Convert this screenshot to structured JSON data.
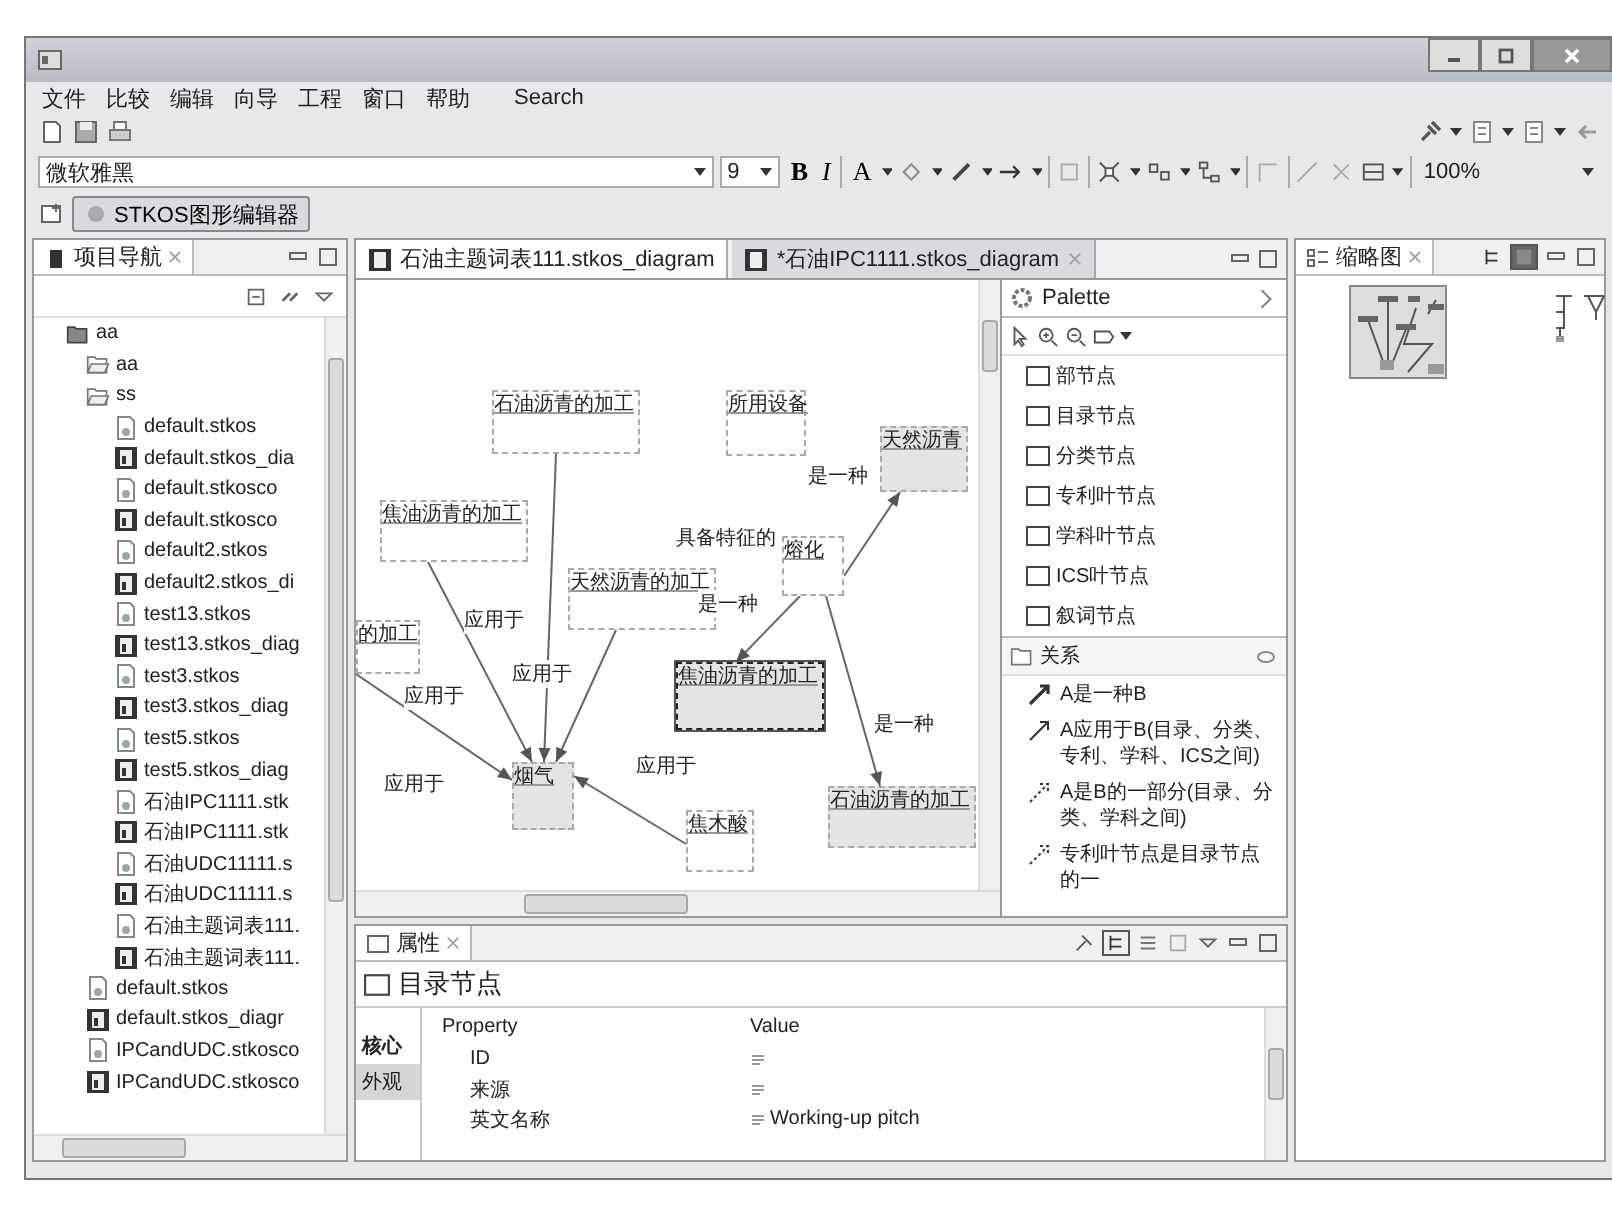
{
  "menu": [
    "文件",
    "比较",
    "编辑",
    "向导",
    "工程",
    "窗口",
    "帮助",
    "Search"
  ],
  "toolbar": {
    "font": "微软雅黑",
    "size": "9",
    "bold": "B",
    "italic": "I",
    "font_color": "A",
    "zoom": "100%"
  },
  "perspective": "STKOS图形编辑器",
  "navigator": {
    "title": "项目导航",
    "tree": [
      {
        "label": "aa",
        "kind": "project",
        "children": [
          {
            "label": "aa",
            "kind": "folder"
          },
          {
            "label": "ss",
            "kind": "folder",
            "children": [
              {
                "label": "default.stkos",
                "kind": "model"
              },
              {
                "label": "default.stkos_dia",
                "kind": "diagram"
              },
              {
                "label": "default.stkosco",
                "kind": "model"
              },
              {
                "label": "default.stkosco",
                "kind": "diagram"
              },
              {
                "label": "default2.stkos",
                "kind": "model"
              },
              {
                "label": "default2.stkos_di",
                "kind": "diagram"
              },
              {
                "label": "test13.stkos",
                "kind": "model"
              },
              {
                "label": "test13.stkos_diag",
                "kind": "diagram"
              },
              {
                "label": "test3.stkos",
                "kind": "model"
              },
              {
                "label": "test3.stkos_diag",
                "kind": "diagram"
              },
              {
                "label": "test5.stkos",
                "kind": "model"
              },
              {
                "label": "test5.stkos_diag",
                "kind": "diagram"
              },
              {
                "label": "石油IPC1111.stk",
                "kind": "model"
              },
              {
                "label": "石油IPC1111.stk",
                "kind": "diagram"
              },
              {
                "label": "石油UDC11111.s",
                "kind": "model"
              },
              {
                "label": "石油UDC11111.s",
                "kind": "diagram"
              },
              {
                "label": "石油主题词表111.",
                "kind": "model"
              },
              {
                "label": "石油主题词表111.",
                "kind": "diagram"
              }
            ]
          },
          {
            "label": "default.stkos",
            "kind": "model"
          },
          {
            "label": "default.stkos_diagr",
            "kind": "diagram"
          },
          {
            "label": "IPCandUDC.stkosco",
            "kind": "model"
          },
          {
            "label": "IPCandUDC.stkosco",
            "kind": "diagram"
          }
        ]
      }
    ]
  },
  "editor": {
    "tabs": [
      {
        "label": "石油主题词表111.stkos_diagram",
        "selected": true
      },
      {
        "label": "*石油IPC1111.stkos_diagram",
        "selected": false
      }
    ],
    "nodes": [
      {
        "label": "石油沥青的加工",
        "kind": "plain",
        "selected": false
      },
      {
        "label": "所用设备",
        "kind": "plain",
        "selected": false
      },
      {
        "label": "天然沥青",
        "kind": "shaded",
        "selected": false
      },
      {
        "label": "焦油沥青的加工",
        "kind": "plain",
        "selected": false
      },
      {
        "label": "的加工",
        "kind": "plain",
        "selected": false
      },
      {
        "label": "天然沥青的加工",
        "kind": "plain",
        "selected": false
      },
      {
        "label": "熔化",
        "kind": "plain",
        "selected": false
      },
      {
        "label": "焦油沥青的加工",
        "kind": "shaded",
        "selected": true
      },
      {
        "label": "烟气",
        "kind": "shaded",
        "selected": false
      },
      {
        "label": "焦木酸",
        "kind": "plain",
        "selected": false
      },
      {
        "label": "石油沥青的加工",
        "kind": "shaded",
        "selected": false
      }
    ],
    "edge_labels": [
      "是一种",
      "具备特征的",
      "是一种",
      "应用于",
      "应用于",
      "应用于",
      "应用于",
      "应用于",
      "是一种"
    ]
  },
  "palette": {
    "title": "Palette",
    "tools": [
      "部节点",
      "目录节点",
      "分类节点",
      "专利叶节点",
      "学科叶节点",
      "ICS叶节点",
      "叙词节点"
    ],
    "drawer": "关系",
    "relations": [
      "A是一种B",
      "A应用于B(目录、分类、专利、学科、ICS之间)",
      "A是B的一部分(目录、分类、学科之间)",
      "专利叶节点是目录节点的一"
    ]
  },
  "outline": {
    "title": "缩略图"
  },
  "properties": {
    "title": "属性",
    "heading": "目录节点",
    "side_tabs": [
      {
        "label": "核心",
        "selected": true
      },
      {
        "label": "外观",
        "selected": false
      }
    ],
    "columns": [
      "Property",
      "Value"
    ],
    "rows": [
      {
        "property": "ID"
      },
      {
        "property": "来源"
      },
      {
        "property": "英文名称",
        "value": "Working-up pitch"
      }
    ]
  }
}
